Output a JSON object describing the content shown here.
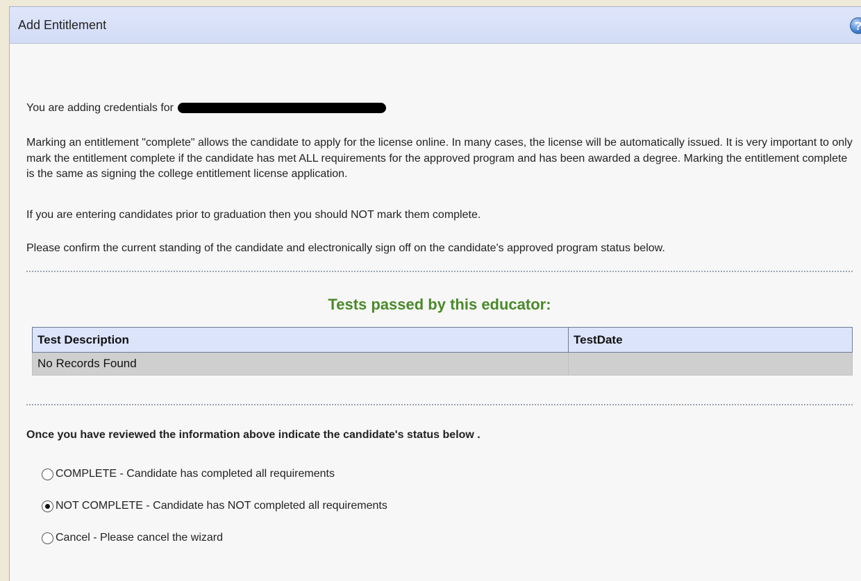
{
  "header": {
    "title": "Add Entitlement",
    "help_icon": "help-icon"
  },
  "intro": {
    "adding_for": "You are adding credentials for",
    "paragraph1": "Marking an entitlement \"complete\" allows the candidate to apply for the license online. In many cases, the license will be automatically issued. It is very important to only mark the entitlement complete if the candidate has met ALL requirements for the approved program and has been awarded a degree. Marking the entitlement complete is the same as signing the college entitlement license application.",
    "paragraph2": "If you are entering candidates prior to graduation then you should NOT mark them complete.",
    "paragraph3": "Please confirm the current standing of the candidate and electronically sign off on the candidate's approved program status below."
  },
  "tests": {
    "title": "Tests passed by this educator:",
    "columns": [
      "Test Description",
      "TestDate"
    ],
    "rows": [
      [
        "No Records Found",
        ""
      ]
    ]
  },
  "status": {
    "prompt": "Once you have reviewed the information above indicate the candidate's status below .",
    "options": [
      {
        "label": "COMPLETE - Candidate has completed all requirements",
        "checked": false
      },
      {
        "label": "NOT COMPLETE - Candidate has NOT completed all requirements",
        "checked": true
      },
      {
        "label": "Cancel - Please cancel the wizard",
        "checked": false
      }
    ]
  },
  "colors": {
    "header_bg": "#dbe4fb",
    "section_title": "#4a8a2a"
  }
}
